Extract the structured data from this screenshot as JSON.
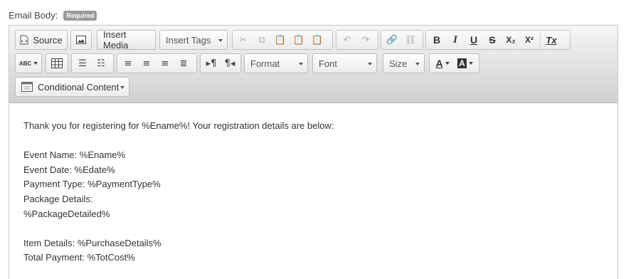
{
  "field": {
    "label": "Email Body:",
    "badge": "Required"
  },
  "toolbar": {
    "source_label": "Source",
    "insert_media_label": "Insert Media",
    "insert_tags_label": "Insert Tags",
    "format_label": "Format",
    "font_label": "Font",
    "size_label": "Size",
    "conditional_label": "Conditional Content",
    "spell_label": "ABC"
  },
  "icons": {
    "bold": "B",
    "italic": "I",
    "underline": "U",
    "strike": "S",
    "subscript": "X₂",
    "superscript": "X²",
    "remove_format": "Tx",
    "text_color": "A",
    "bg_color": "A"
  },
  "body_lines": [
    "Thank you for registering for %Ename%! Your registration details are below:",
    "",
    "Event Name: %Ename%",
    "Event Date: %Edate%",
    "Payment Type: %PaymentType%",
    "Package Details:",
    "%PackageDetailed%",
    "",
    "Item Details: %PurchaseDetails%",
    "Total Payment: %TotCost%"
  ]
}
